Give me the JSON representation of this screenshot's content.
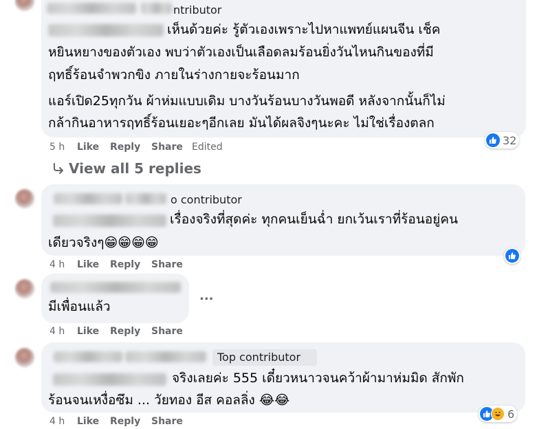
{
  "comments": [
    {
      "badge": "ntributor",
      "lines": [
        "เห็นด้วยค่ะ รู้ตัวเองเพราะไปหาแพทย์แผนจีน เช็ค",
        "หยินหยางของตัวเอง พบว่าตัวเองเป็นเลือดลมร้อนยิ่งวันไหนกินของที่มี",
        "ฤทธิ์ร้อนจำพวกขิง ภายในร่างกายจะร้อนมาก",
        "แอร์เปิด25ทุกวัน ผ้าห่มแบบเดิม บางวันร้อนบางวันพอดี หลังจากนั้นก็ไม่",
        "กล้ากินอาหารฤทธิ์ร้อนเยอะๆอีกเลย มันได้ผลจิงๆนะคะ ไม่ใช่เรื่องตลก"
      ],
      "time": "5 h",
      "like": "Like",
      "reply": "Reply",
      "share": "Share",
      "edited": "Edited",
      "reaction_count": "32"
    },
    {
      "badge": "o contributor",
      "lines": [
        "เรื่องจริงที่สุดค่ะ ทุกคนเย็นฉ่ำ ยกเว้นเราที่ร้อนอยู่คน",
        "เดียวจริงๆ😁😁😁😁"
      ],
      "time": "4 h",
      "like": "Like",
      "reply": "Reply",
      "share": "Share"
    },
    {
      "lines": [
        "มีเพื่อนแล้ว"
      ],
      "time": "4 h",
      "like": "Like",
      "reply": "Reply",
      "share": "Share",
      "more": "..."
    },
    {
      "badge": "Top contributor",
      "lines": [
        "จริงเลยค่ะ 555 เดี๋ยวหนาวจนคว้าผ้ามาห่มมิด สักพัก",
        "ร้อนจนเหงื่อซึม ... วัยทอง อีส คอลลิ่ง 😂😂"
      ],
      "time": "4 h",
      "like": "Like",
      "reply": "Reply",
      "share": "Share",
      "reaction_count": "6"
    }
  ],
  "view_replies": "View all 5 replies",
  "icons": {
    "like": "like-icon",
    "haha": "haha-icon",
    "reply_arrow": "reply-arrow-icon",
    "more": "more-icon"
  },
  "colors": {
    "bubble": "#f0f2f5",
    "meta": "#65676b",
    "like_blue": "#1877f2",
    "haha_yellow": "#f7b125"
  }
}
